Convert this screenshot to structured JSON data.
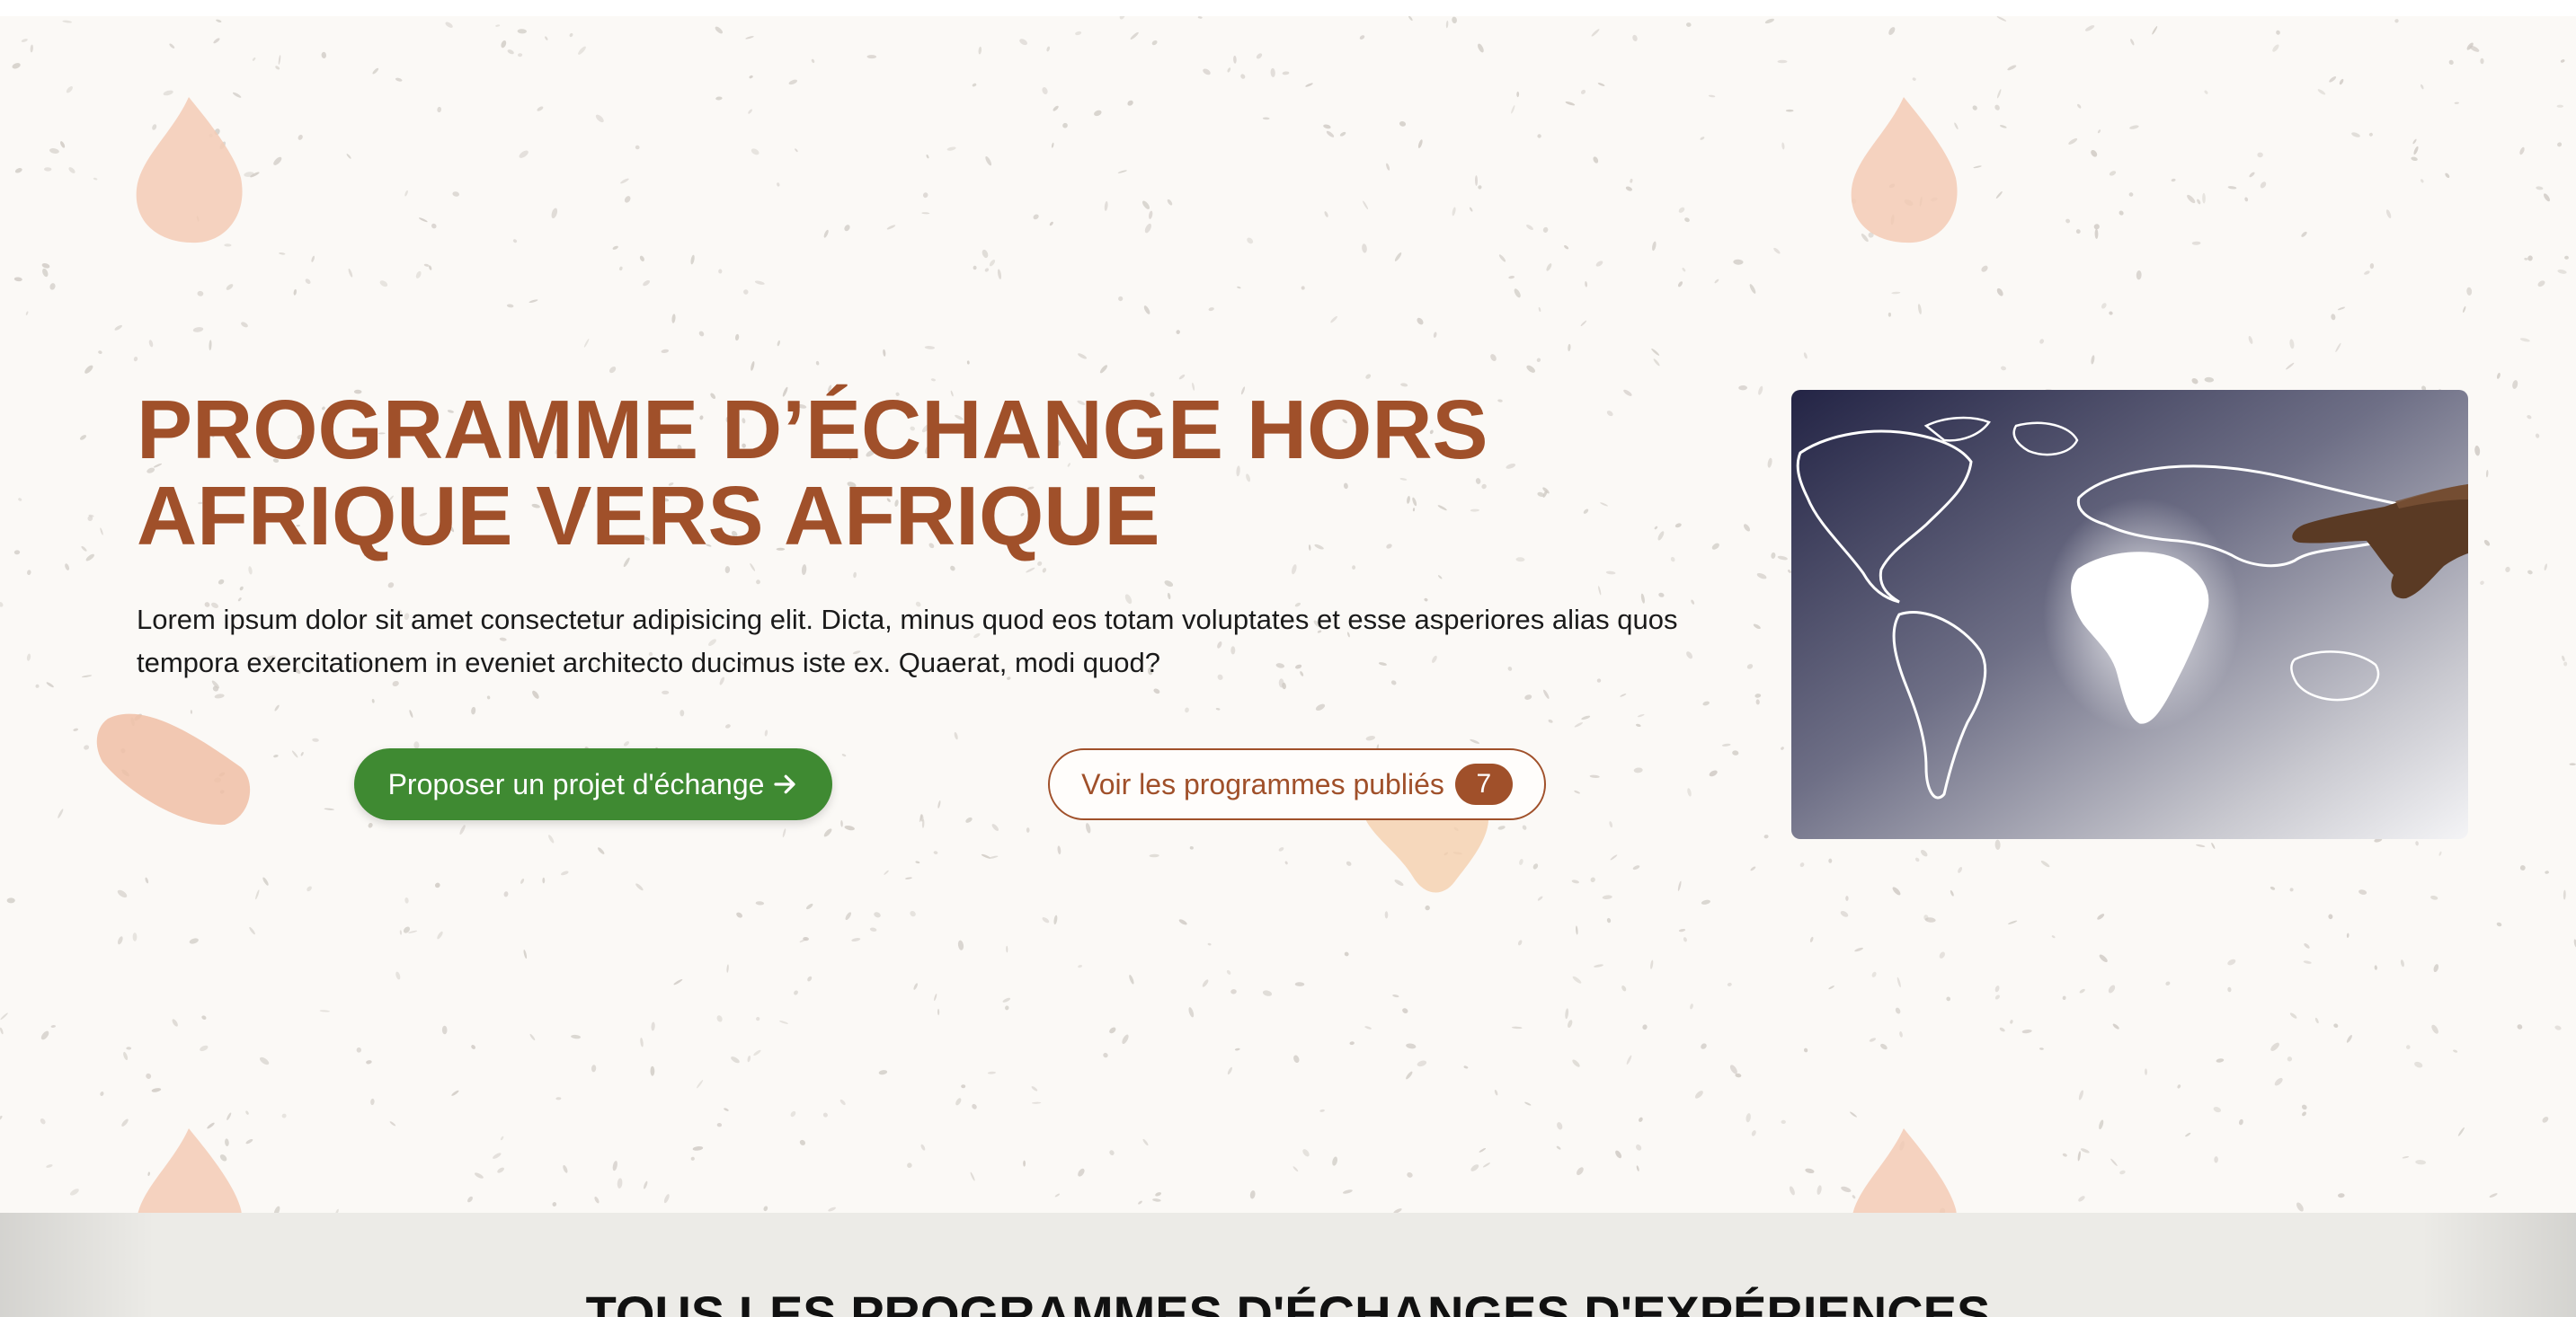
{
  "hero": {
    "title_line1": "PROGRAMME D’ÉCHANGE HORS",
    "title_line2": "AFRIQUE VERS AFRIQUE",
    "description": "Lorem ipsum dolor sit amet consectetur adipisicing elit. Dicta, minus quod eos totam voluptates et esse asperiores alias quos tempora exercitationem in eveniet architecto ducimus iste ex. Quaerat, modi quod?",
    "primary_button": {
      "label": "Proposer un projet d'échange",
      "icon": "arrow-right-icon"
    },
    "secondary_button": {
      "label": "Voir les programmes publiés",
      "count": "7"
    },
    "image": {
      "subject": "world-map-with-pointing-hand"
    }
  },
  "section": {
    "title": "TOUS LES PROGRAMMES D'ÉCHANGES D'EXPÉRIENCES"
  },
  "colors": {
    "brand_brown": "#a0502a",
    "primary_green": "#3f8a32",
    "hero_background": "#fbf9f6",
    "blob_peach": "#f3cbb5",
    "section_background": "#ecebe7"
  }
}
